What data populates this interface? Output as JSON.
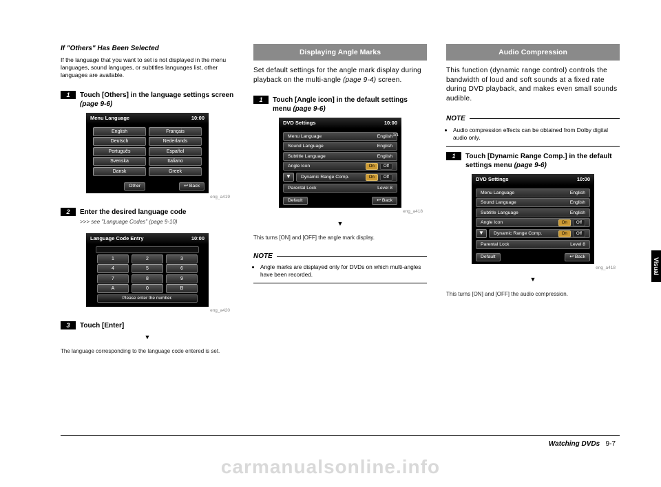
{
  "col1": {
    "heading_it": "If \"Others\" Has Been Selected",
    "intro": "If the language that you want to set is not displayed in the menu languages, sound languges, or subtitles languages list, other languages are available.",
    "step1": "Touch [Others] in the language settings screen",
    "step1_ref": "(page 9-6)",
    "screen1": {
      "title": "Menu Language",
      "time": "10:00",
      "rows": [
        [
          "English",
          "Français"
        ],
        [
          "Deutsch",
          "Nederlands"
        ],
        [
          "Português",
          "Español"
        ],
        [
          "Svenska",
          "Italiano"
        ],
        [
          "Dansk",
          "Greek"
        ]
      ],
      "other": "Other",
      "back": "Back",
      "fig": "eng_a419"
    },
    "step2": "Enter the desired language code",
    "step2_ref": ">>> see \"Language Codes\" (page 9-10)",
    "screen2": {
      "title": "Language Code Entry",
      "time": "10:00",
      "rows": [
        [
          "1",
          "2",
          "3"
        ],
        [
          "4",
          "5",
          "6"
        ],
        [
          "7",
          "8",
          "9"
        ],
        [
          "A",
          "0",
          "B"
        ]
      ],
      "prompt": "Please enter the number.",
      "fig": "eng_a420"
    },
    "step3": "Touch [Enter]",
    "result": "The language corresponding to the language code entered is set."
  },
  "col2": {
    "head": "Displaying Angle Marks",
    "intro1": "Set default settings for the angle mark display during playback on the multi-angle",
    "intro_ref": "(page 9-4)",
    "intro2": "screen.",
    "step1": "Touch [Angle icon] in the default settings menu",
    "step1_ref": "(page 9-6)",
    "screen": {
      "title": "DVD Settings",
      "time": "10:00",
      "page": "1/1",
      "rows": [
        {
          "l": "Menu Language",
          "r": "English"
        },
        {
          "l": "Sound Language",
          "r": "English"
        },
        {
          "l": "Subtitle Language",
          "r": "English"
        },
        {
          "l": "Angle Icon",
          "r_on": "On",
          "r_off": "Off"
        },
        {
          "l": "Dynamic Range Comp.",
          "r_on": "On",
          "r_off": "Off"
        },
        {
          "l": "Parental Lock",
          "r": "Level 8"
        }
      ],
      "default": "Default",
      "back": "Back",
      "fig": "eng_a418"
    },
    "result": "This turns [ON] and [OFF] the angle mark display.",
    "note_head": "NOTE",
    "note1": "Angle marks are displayed only for DVDs on which multi-angles have been recorded."
  },
  "col3": {
    "head": "Audio Compression",
    "intro": "This function (dynamic range control) controls the bandwidth of loud and soft sounds at a fixed rate during DVD playback, and makes even small sounds audible.",
    "note_head": "NOTE",
    "note1": "Audio compression effects can be obtained from Dolby digital audio only.",
    "step1": "Touch [Dynamic Range Comp.] in the default settings menu",
    "step1_ref": "(page 9-6)",
    "screen": {
      "title": "DVD Settings",
      "time": "10:00",
      "rows": [
        {
          "l": "Menu Language",
          "r": "English"
        },
        {
          "l": "Sound Language",
          "r": "English"
        },
        {
          "l": "Subtitle Language",
          "r": "English"
        },
        {
          "l": "Angle Icon",
          "r_on": "On",
          "r_off": "Off"
        },
        {
          "l": "Dynamic Range Comp.",
          "r_on": "On",
          "r_off": "Off"
        },
        {
          "l": "Parental Lock",
          "r": "Level 8"
        }
      ],
      "default": "Default",
      "back": "Back",
      "fig": "eng_a418"
    },
    "result": "This turns [ON] and [OFF] the audio compression."
  },
  "side_tab": "Visual",
  "footer_section": "Watching DVDs",
  "footer_page": "9-7",
  "watermark": "carmanualsonline.info",
  "triangle": "▼",
  "back_glyph": "↩"
}
